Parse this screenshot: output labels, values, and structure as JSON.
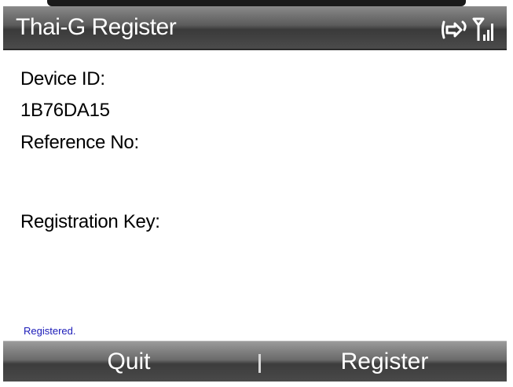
{
  "titlebar": {
    "title": "Thai-G Register",
    "icons": [
      "connection-icon",
      "signal-strength-icon"
    ]
  },
  "content": {
    "device_id_label": "Device ID:",
    "device_id_value": "1B76DA15",
    "reference_label": "Reference No:",
    "registration_key_label": "Registration Key:",
    "status": "Registered."
  },
  "softkeys": {
    "left_label": "Quit",
    "right_label": "Register"
  },
  "colors": {
    "status_text": "#1a1ab8",
    "bar_dark": "#3a3a3a",
    "bar_light": "#8a8a8a"
  }
}
